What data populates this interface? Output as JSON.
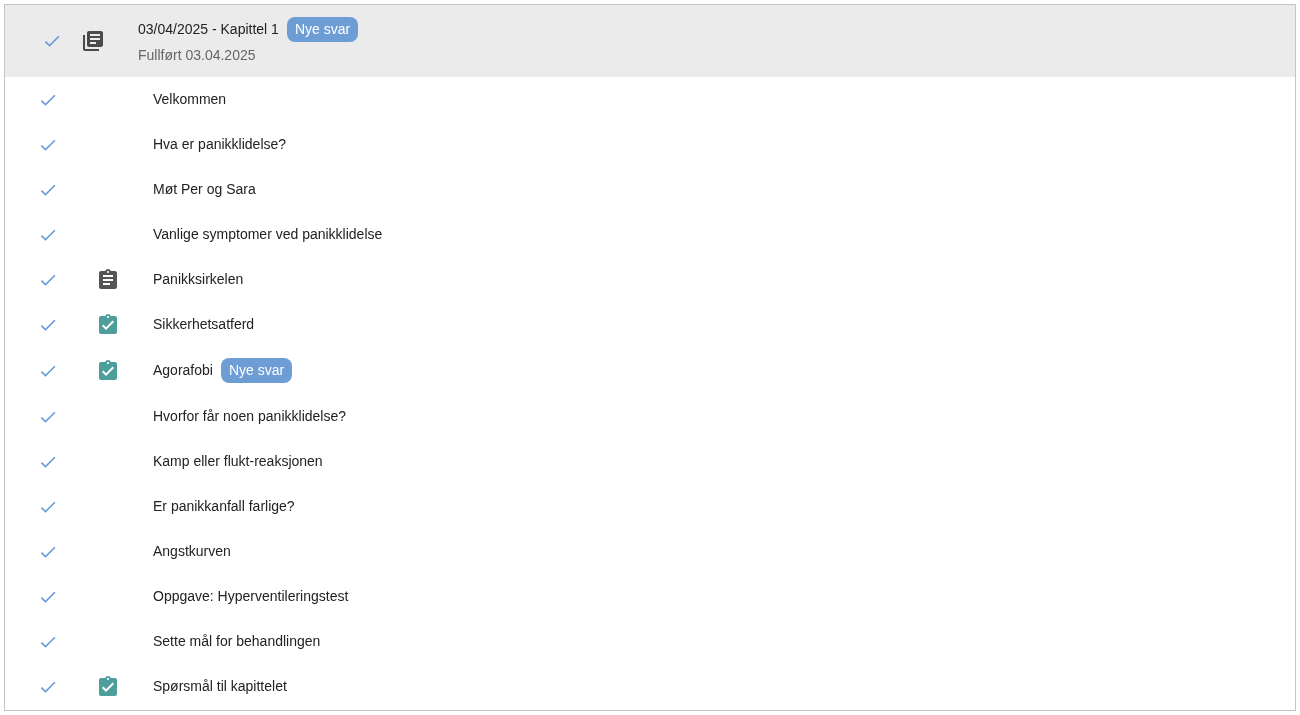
{
  "chapter": {
    "title": "03/04/2025 - Kapittel 1",
    "badge": "Nye svar",
    "subtitle": "Fullført 03.04.2025",
    "completed": true,
    "selected": true
  },
  "items": [
    {
      "label": "Velkommen",
      "completed": true,
      "kind": "page"
    },
    {
      "label": "Hva er panikklidelse?",
      "completed": true,
      "kind": "page"
    },
    {
      "label": "Møt Per og Sara",
      "completed": true,
      "kind": "page"
    },
    {
      "label": "Vanlige symptomer ved panikklidelse",
      "completed": true,
      "kind": "page"
    },
    {
      "label": "Panikksirkelen",
      "completed": true,
      "kind": "task"
    },
    {
      "label": "Sikkerhetsatferd",
      "completed": true,
      "kind": "task-done"
    },
    {
      "label": "Agorafobi",
      "completed": true,
      "kind": "task-done",
      "badge": "Nye svar"
    },
    {
      "label": "Hvorfor får noen panikklidelse?",
      "completed": true,
      "kind": "page"
    },
    {
      "label": "Kamp eller flukt-reaksjonen",
      "completed": true,
      "kind": "page"
    },
    {
      "label": "Er panikkanfall farlige?",
      "completed": true,
      "kind": "page"
    },
    {
      "label": "Angstkurven",
      "completed": true,
      "kind": "page"
    },
    {
      "label": "Oppgave: Hyperventileringstest",
      "completed": true,
      "kind": "page"
    },
    {
      "label": "Sette mål for behandlingen",
      "completed": true,
      "kind": "page"
    },
    {
      "label": "Spørsmål til kapittelet",
      "completed": true,
      "kind": "task-done"
    }
  ]
}
